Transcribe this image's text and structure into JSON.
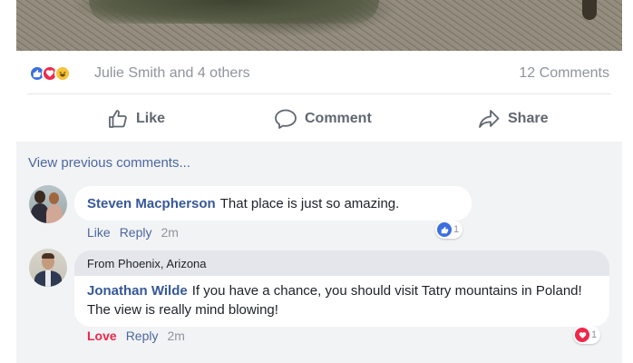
{
  "post": {
    "reactions": [
      {
        "type": "like",
        "icon": "thumbs-up-icon",
        "color": "#3b6fe0"
      },
      {
        "type": "love",
        "icon": "heart-icon",
        "color": "#f0284a"
      },
      {
        "type": "haha",
        "icon": "laughing-face-icon",
        "color": "#f7c33a"
      }
    ],
    "reaction_summary": "Julie Smith and 4 others",
    "comment_count": "12 Comments"
  },
  "actions": {
    "like": "Like",
    "comment": "Comment",
    "share": "Share"
  },
  "comments_section": {
    "view_previous": "View previous comments..."
  },
  "comments": [
    {
      "author": "Steven Macpherson",
      "text": "That place is just so amazing.",
      "like_label": "Like",
      "reply_label": "Reply",
      "time": "2m",
      "reaction_icon": "thumbs-up-icon",
      "reaction_count": "1"
    },
    {
      "header": "From Phoenix, Arizona",
      "author": "Jonathan Wilde",
      "text": "If you have a chance, you should visit Tatry mountains in Poland! The view is really mind blowing!",
      "like_label": "Love",
      "reply_label": "Reply",
      "time": "2m",
      "reaction_icon": "heart-icon",
      "reaction_count": "1"
    }
  ],
  "colors": {
    "link_blue": "#365899",
    "meta_gray": "#90949c",
    "love_red": "#f0284a",
    "comments_bg": "#f2f3f5"
  }
}
